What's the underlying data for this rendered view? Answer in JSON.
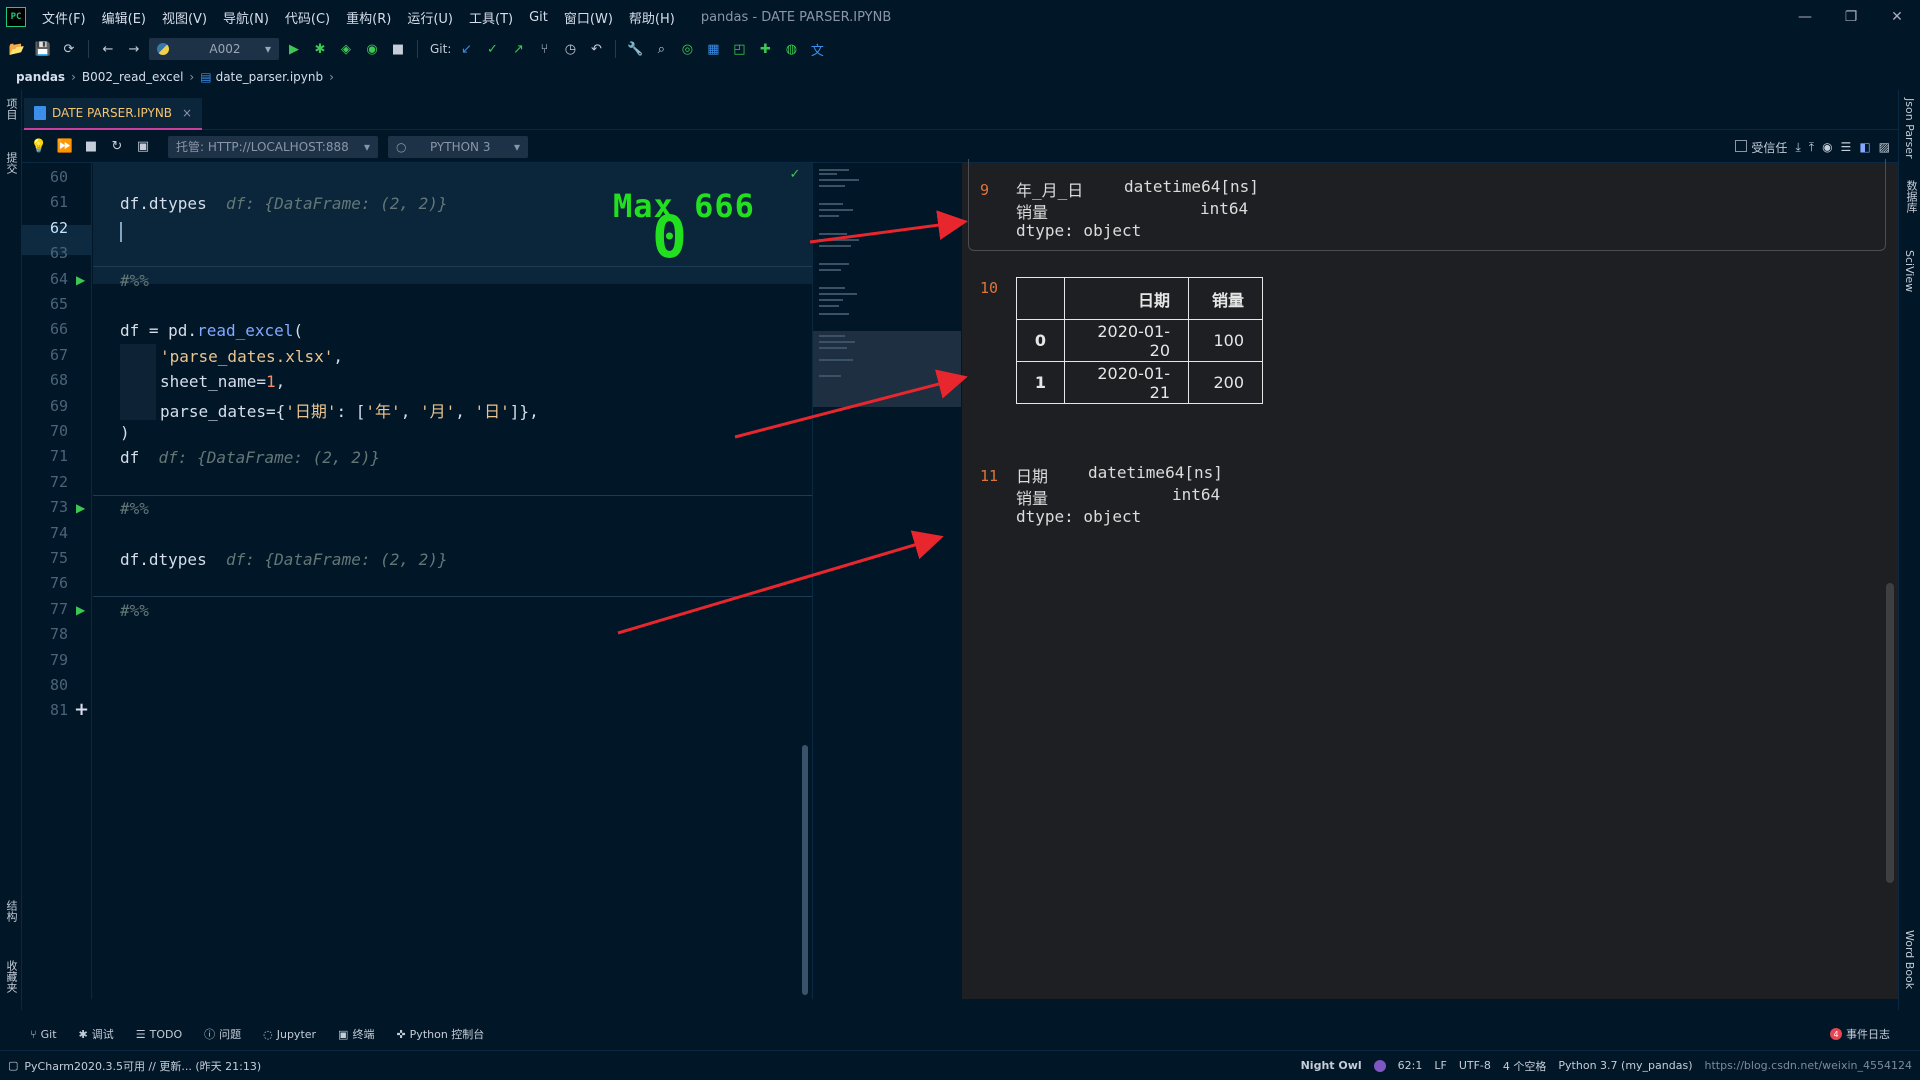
{
  "app": {
    "logo_text": "PC",
    "window_title": "pandas - DATE PARSER.IPYNB",
    "menu": [
      "文件(F)",
      "编辑(E)",
      "视图(V)",
      "导航(N)",
      "代码(C)",
      "重构(R)",
      "运行(U)",
      "工具(T)",
      "Git",
      "窗口(W)",
      "帮助(H)"
    ]
  },
  "toolbar": {
    "run_config": "A002",
    "git_label": "Git:"
  },
  "breadcrumb": [
    "pandas",
    "B002_read_excel",
    "date_parser.ipynb"
  ],
  "tab": {
    "label": "DATE PARSER.IPYNB",
    "close": "×"
  },
  "notebook_toolbar": {
    "server": "托管: HTTP://LOCALHOST:888",
    "kernel": "PYTHON 3",
    "trusted_label": "受信任"
  },
  "left_strip": [
    "项目",
    "提交",
    "结构",
    "收藏夹"
  ],
  "right_strip": [
    "Json Parser",
    "数据库",
    "SciView",
    "Word Book"
  ],
  "editor": {
    "line_numbers": [
      "60",
      "61",
      "62",
      "63",
      "64",
      "65",
      "66",
      "67",
      "68",
      "69",
      "70",
      "71",
      "72",
      "73",
      "74",
      "75",
      "76",
      "77",
      "78",
      "79",
      "80",
      "81"
    ],
    "current_line": "62",
    "lines": {
      "l61_code": "df.dtypes",
      "l61_hint": "df: {DataFrame: (2, 2)}",
      "l64": "#%%",
      "l66_a": "df = pd.",
      "l66_fn": "read_excel",
      "l66_b": "(",
      "l67_str": "'parse_dates.xlsx'",
      "l67_b": ",",
      "l68_a": "sheet_name=",
      "l68_num": "1",
      "l68_b": ",",
      "l69_a": "parse_dates={",
      "l69_s1": "'日期'",
      "l69_b": ": [",
      "l69_s2": "'年'",
      "l69_c": ", ",
      "l69_s3": "'月'",
      "l69_d": ", ",
      "l69_s4": "'日'",
      "l69_e": "]},",
      "l70": ")",
      "l71_code": "df",
      "l71_hint": "df: {DataFrame: (2, 2)}",
      "l73": "#%%",
      "l75_code": "df.dtypes",
      "l75_hint": "df: {DataFrame: (2, 2)}",
      "l77": "#%%"
    },
    "overlay_title": "Max 666",
    "overlay_big": "0"
  },
  "output": {
    "out9": {
      "num": "9",
      "rows": [
        {
          "name": "年_月_日",
          "type": "datetime64[ns]"
        },
        {
          "name": "销量",
          "type": "int64"
        }
      ],
      "dtype": "dtype: object"
    },
    "out10": {
      "num": "10",
      "columns": [
        "",
        "日期",
        "销量"
      ],
      "rows": [
        {
          "index": "0",
          "date": "2020-01-20",
          "sales": "100"
        },
        {
          "index": "1",
          "date": "2020-01-21",
          "sales": "200"
        }
      ]
    },
    "out11": {
      "num": "11",
      "rows": [
        {
          "name": "日期",
          "type": "datetime64[ns]"
        },
        {
          "name": "销量",
          "type": "int64"
        }
      ],
      "dtype": "dtype: object"
    }
  },
  "bottom_tools": [
    "Git",
    "调试",
    "TODO",
    "问题",
    "Jupyter",
    "终端",
    "Python 控制台"
  ],
  "event_log": {
    "count": "4",
    "label": "事件日志"
  },
  "status": {
    "left": "PyCharm2020.3.5可用 // 更新... (昨天 21:13)",
    "theme": "Night Owl",
    "position": "62:1",
    "line_sep": "LF",
    "encoding": "UTF-8",
    "indent": "4 个空格",
    "interpreter": "Python 3.7 (my_pandas)",
    "watermark": "https://blog.csdn.net/weixin_4554124"
  },
  "colors": {
    "bg": "#011627",
    "output_bg": "#1e1f22",
    "accent_green": "#22e01f",
    "arrow_red": "#e8262d",
    "tab_text": "#f7c56d"
  }
}
